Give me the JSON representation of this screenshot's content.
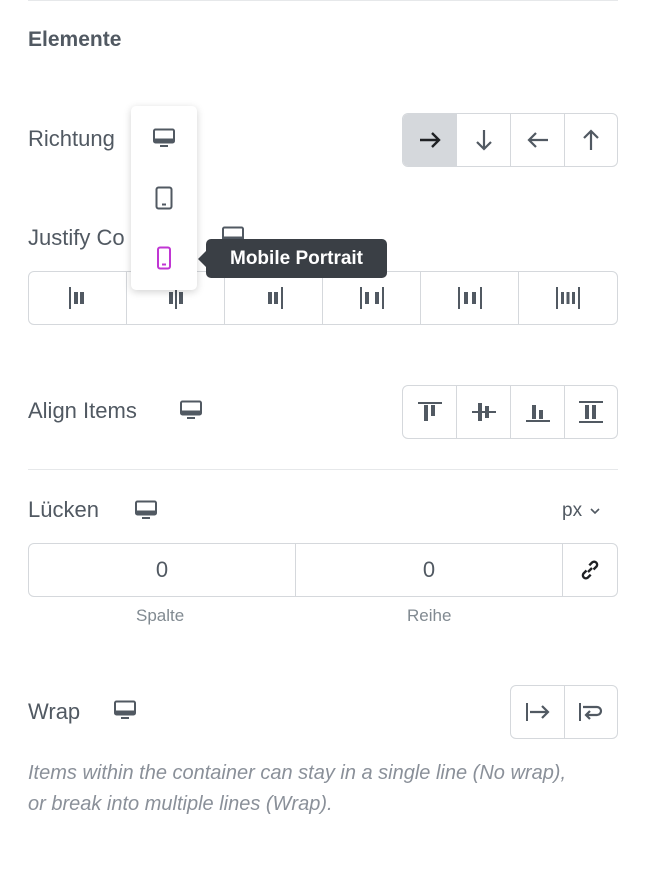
{
  "section": {
    "title": "Elemente"
  },
  "direction": {
    "label": "Richtung",
    "options": [
      {
        "icon": "arrow-right-icon",
        "active": true
      },
      {
        "icon": "arrow-down-icon",
        "active": false
      },
      {
        "icon": "arrow-left-icon",
        "active": false
      },
      {
        "icon": "arrow-up-icon",
        "active": false
      }
    ]
  },
  "justify": {
    "label": "Justify Co",
    "options": [
      "justify-start",
      "justify-center",
      "justify-end",
      "space-between",
      "space-around",
      "space-evenly"
    ]
  },
  "device_dropdown": {
    "items": [
      "desktop",
      "tablet",
      "mobile"
    ],
    "selected": "mobile",
    "tooltip": "Mobile Portrait",
    "accent_color": "#c036d3"
  },
  "align_items": {
    "label": "Align Items",
    "options": [
      "align-start",
      "align-center",
      "align-end",
      "align-stretch"
    ]
  },
  "gaps": {
    "label": "Lücken",
    "unit": "px",
    "column_value": "0",
    "row_value": "0",
    "column_caption": "Spalte",
    "row_caption": "Reihe"
  },
  "wrap": {
    "label": "Wrap",
    "options": [
      "nowrap",
      "wrap"
    ],
    "help": "Items within the container can stay in a single line (No wrap), or break into multiple lines (Wrap)."
  }
}
